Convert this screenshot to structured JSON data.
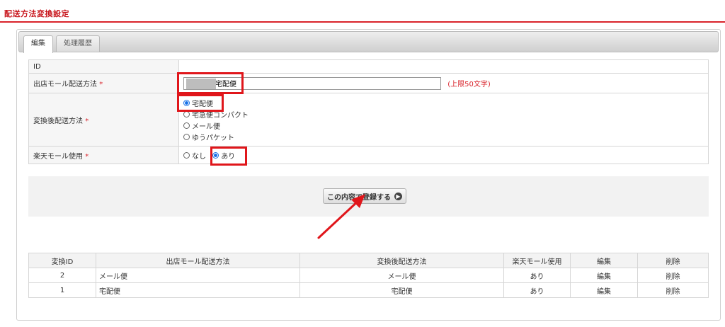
{
  "page": {
    "title": "配送方法変換設定"
  },
  "tabs": [
    {
      "label": "編集",
      "active": true
    },
    {
      "label": "処理履歴",
      "active": false
    }
  ],
  "form": {
    "id_label": "ID",
    "id_value": "",
    "store_method_label": "出店モール配送方法",
    "store_method_value": "宅配便",
    "store_method_limit": "(上限50文字)",
    "converted_label": "変換後配送方法",
    "converted_options": [
      "宅配便",
      "宅急便コンパクト",
      "メール便",
      "ゆうパケット"
    ],
    "converted_selected": "宅配便",
    "rakuten_label": "楽天モール使用",
    "rakuten_options": [
      "なし",
      "あり"
    ],
    "rakuten_selected": "あり",
    "required_mark": "*"
  },
  "submit": {
    "label": "この内容で登録する",
    "icon": "arrow-right-circle-icon"
  },
  "list": {
    "headers": [
      "変換ID",
      "出店モール配送方法",
      "変換後配送方法",
      "楽天モール使用",
      "編集",
      "削除"
    ],
    "rows": [
      {
        "id": "2",
        "store": "メール便",
        "converted": "メール便",
        "rakuten": "あり",
        "edit": "編集",
        "delete": "削除"
      },
      {
        "id": "1",
        "store": "宅配便",
        "converted": "宅配便",
        "rakuten": "あり",
        "edit": "編集",
        "delete": "削除"
      }
    ]
  },
  "colors": {
    "accent": "#d9232b",
    "highlight": "#e0161b",
    "radio": "#1a73e8"
  }
}
